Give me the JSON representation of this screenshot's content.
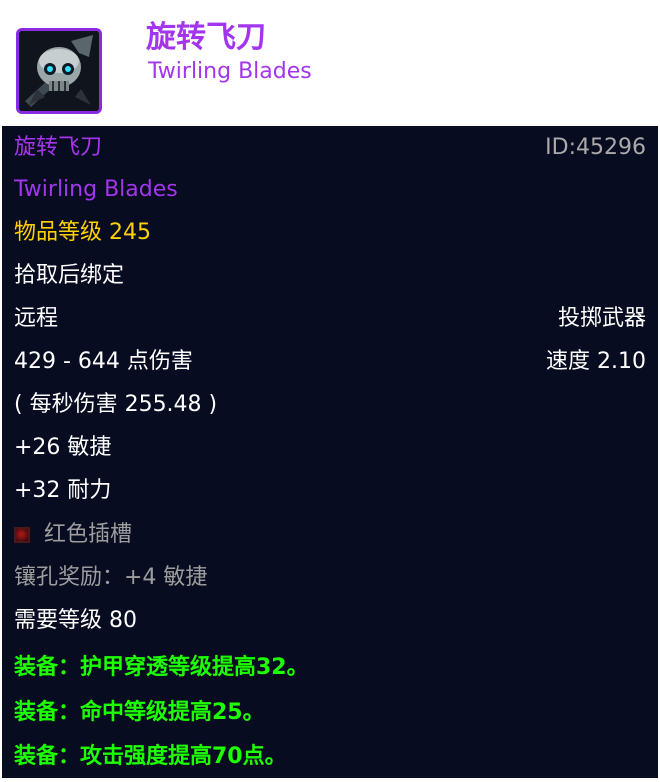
{
  "header": {
    "icon": "skull-axe-icon",
    "title_cn": "旋转飞刀",
    "title_en": "Twirling Blades"
  },
  "tooltip": {
    "name_cn": "旋转飞刀",
    "id": "ID:45296",
    "name_en": "Twirling Blades",
    "item_level": "物品等级 245",
    "bind": "拾取后绑定",
    "slot": "远程",
    "type": "投掷武器",
    "damage": "429 - 644 点伤害",
    "speed": "速度 2.10",
    "dps": "( 每秒伤害 255.48 )",
    "stat_agility": "+26 敏捷",
    "stat_stamina": "+32 耐力",
    "socket": "红色插槽",
    "socket_bonus": "镶孔奖励：+4 敏捷",
    "required_level": "需要等级 80",
    "equip_effects": [
      "装备：护甲穿透等级提高32。",
      "装备：命中等级提高25。",
      "装备：攻击强度提高70点。"
    ]
  },
  "colors": {
    "epic": "#a335ee",
    "item_level": "#ffd100",
    "equip": "#1eff00",
    "tooltip_bg": "#070c21"
  }
}
